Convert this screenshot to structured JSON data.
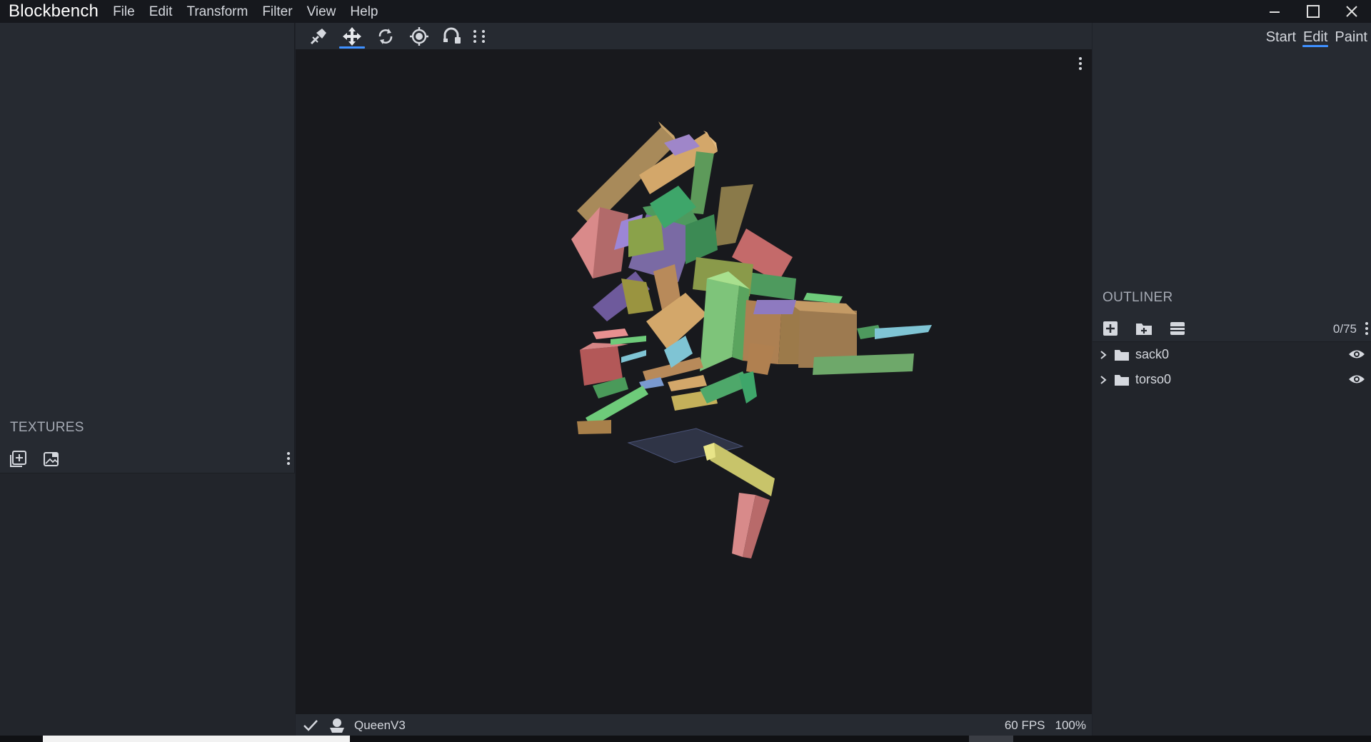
{
  "app": {
    "title": "Blockbench",
    "menu": [
      "File",
      "Edit",
      "Transform",
      "Filter",
      "View",
      "Help"
    ]
  },
  "left_panel": {
    "textures_title": "TEXTURES"
  },
  "toolbar": {
    "tools": [
      {
        "name": "vertex-snap-tool-icon",
        "active": false
      },
      {
        "name": "move-tool-icon",
        "active": true
      },
      {
        "name": "rotate-tool-icon",
        "active": false
      },
      {
        "name": "pivot-tool-icon",
        "active": false
      },
      {
        "name": "vertex-snap-magnet-icon",
        "active": false
      }
    ]
  },
  "mode_tabs": [
    {
      "label": "Start",
      "active": false
    },
    {
      "label": "Edit",
      "active": true
    },
    {
      "label": "Paint",
      "active": false
    }
  ],
  "outliner": {
    "title": "OUTLINER",
    "count": "0/75",
    "items": [
      {
        "label": "sack0"
      },
      {
        "label": "torso0"
      }
    ]
  },
  "statusbar": {
    "project_name": "QueenV3",
    "fps": "60 FPS",
    "zoom": "100%"
  },
  "colors": {
    "accent": "#3e90ff",
    "panel": "#262a31",
    "viewport": "#18191d",
    "titlebar": "#16181d"
  }
}
